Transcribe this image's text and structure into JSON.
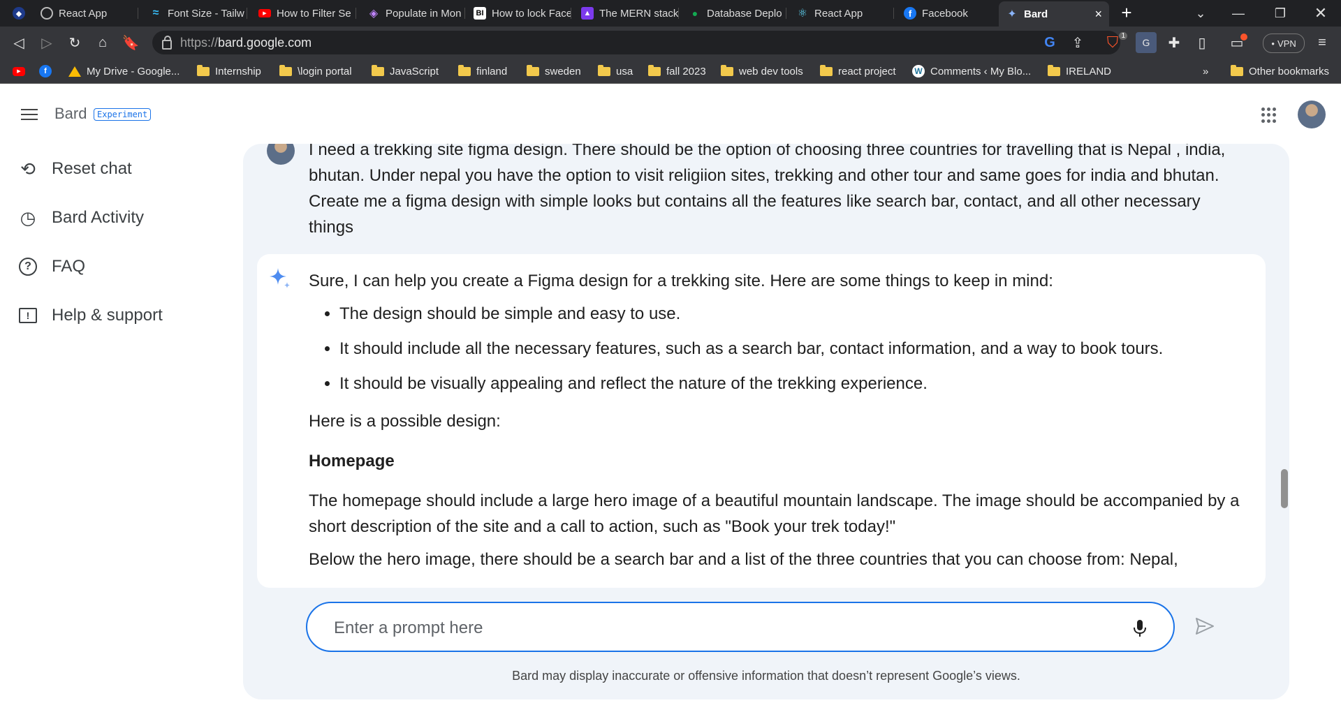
{
  "browser": {
    "tabs": [
      {
        "title": "React App",
        "icon": "globe-icon",
        "color": "#9aa0a6"
      },
      {
        "title": "Font Size - Tailw",
        "icon": "tailwind-icon",
        "color": "#38bdf8"
      },
      {
        "title": "How to Filter Se",
        "icon": "video-icon",
        "color": "#ff0000"
      },
      {
        "title": "Populate in Mon",
        "icon": "diamond-icon",
        "color": "#a855f7"
      },
      {
        "title": "How to lock Face",
        "icon": "bi-icon",
        "color": "#ffffff"
      },
      {
        "title": "The MERN stack",
        "icon": "flask-icon",
        "color": "#7c3aed"
      },
      {
        "title": "Database Deplo",
        "icon": "leaf-icon",
        "color": "#13aa52"
      },
      {
        "title": "React App",
        "icon": "react-icon",
        "color": "#61dafb"
      },
      {
        "title": "Facebook",
        "icon": "facebook-icon",
        "color": "#1877f2"
      },
      {
        "title": "Bard",
        "icon": "bard-icon",
        "color": "#8ab4f8"
      }
    ],
    "new_tab": "+",
    "url_protocol": "https://",
    "url_host": "bard.google.com",
    "vpn_label": "VPN",
    "extension_badge": "1",
    "bookmarks": [
      {
        "label": "My Drive - Google...",
        "type": "drive"
      },
      {
        "label": "Internship",
        "type": "folder"
      },
      {
        "label": "\\login portal",
        "type": "folder"
      },
      {
        "label": "JavaScript",
        "type": "folder"
      },
      {
        "label": "finland",
        "type": "folder"
      },
      {
        "label": "sweden",
        "type": "folder"
      },
      {
        "label": "usa",
        "type": "folder"
      },
      {
        "label": "fall 2023",
        "type": "folder"
      },
      {
        "label": "web dev tools",
        "type": "folder"
      },
      {
        "label": "react project",
        "type": "folder"
      },
      {
        "label": "Comments ‹ My Blo...",
        "type": "wordpress"
      },
      {
        "label": "IRELAND",
        "type": "folder"
      }
    ],
    "bookmarks_overflow": "»",
    "other_bookmarks": "Other bookmarks"
  },
  "app": {
    "brand": "Bard",
    "badge": "Experiment",
    "nav": [
      {
        "label": "Reset chat",
        "icon": "reset-icon"
      },
      {
        "label": "Bard Activity",
        "icon": "history-icon"
      },
      {
        "label": "FAQ",
        "icon": "help-circle-icon"
      },
      {
        "label": "Help & support",
        "icon": "feedback-icon"
      }
    ]
  },
  "chat": {
    "user_query": "I need a trekking site figma design. There should be the option of choosing three countries for travelling that is Nepal , india, bhutan. Under nepal you have the option to visit religiion sites, trekking and other tour and same goes for india and bhutan. Create me a figma design with simple looks but contains all the features like search bar, contact, and all other necessary things",
    "response": {
      "intro": "Sure, I can help you create a Figma design for a trekking site. Here are some things to keep in mind:",
      "bullets": [
        "The design should be simple and easy to use.",
        "It should include all the necessary features, such as a search bar, contact information, and a way to book tours.",
        "It should be visually appealing and reflect the nature of the trekking experience."
      ],
      "possible_design": "Here is a possible design:",
      "homepage_heading": "Homepage",
      "homepage_text": "The homepage should include a large hero image of a beautiful mountain landscape. The image should be accompanied by a short description of the site and a call to action, such as \"Book your trek today!\"",
      "next_text": "Below the hero image, there should be a search bar and a list of the three countries that you can choose from: Nepal,"
    },
    "prompt_placeholder": "Enter a prompt here",
    "disclaimer": "Bard may display inaccurate or offensive information that doesn’t represent Google’s views."
  }
}
